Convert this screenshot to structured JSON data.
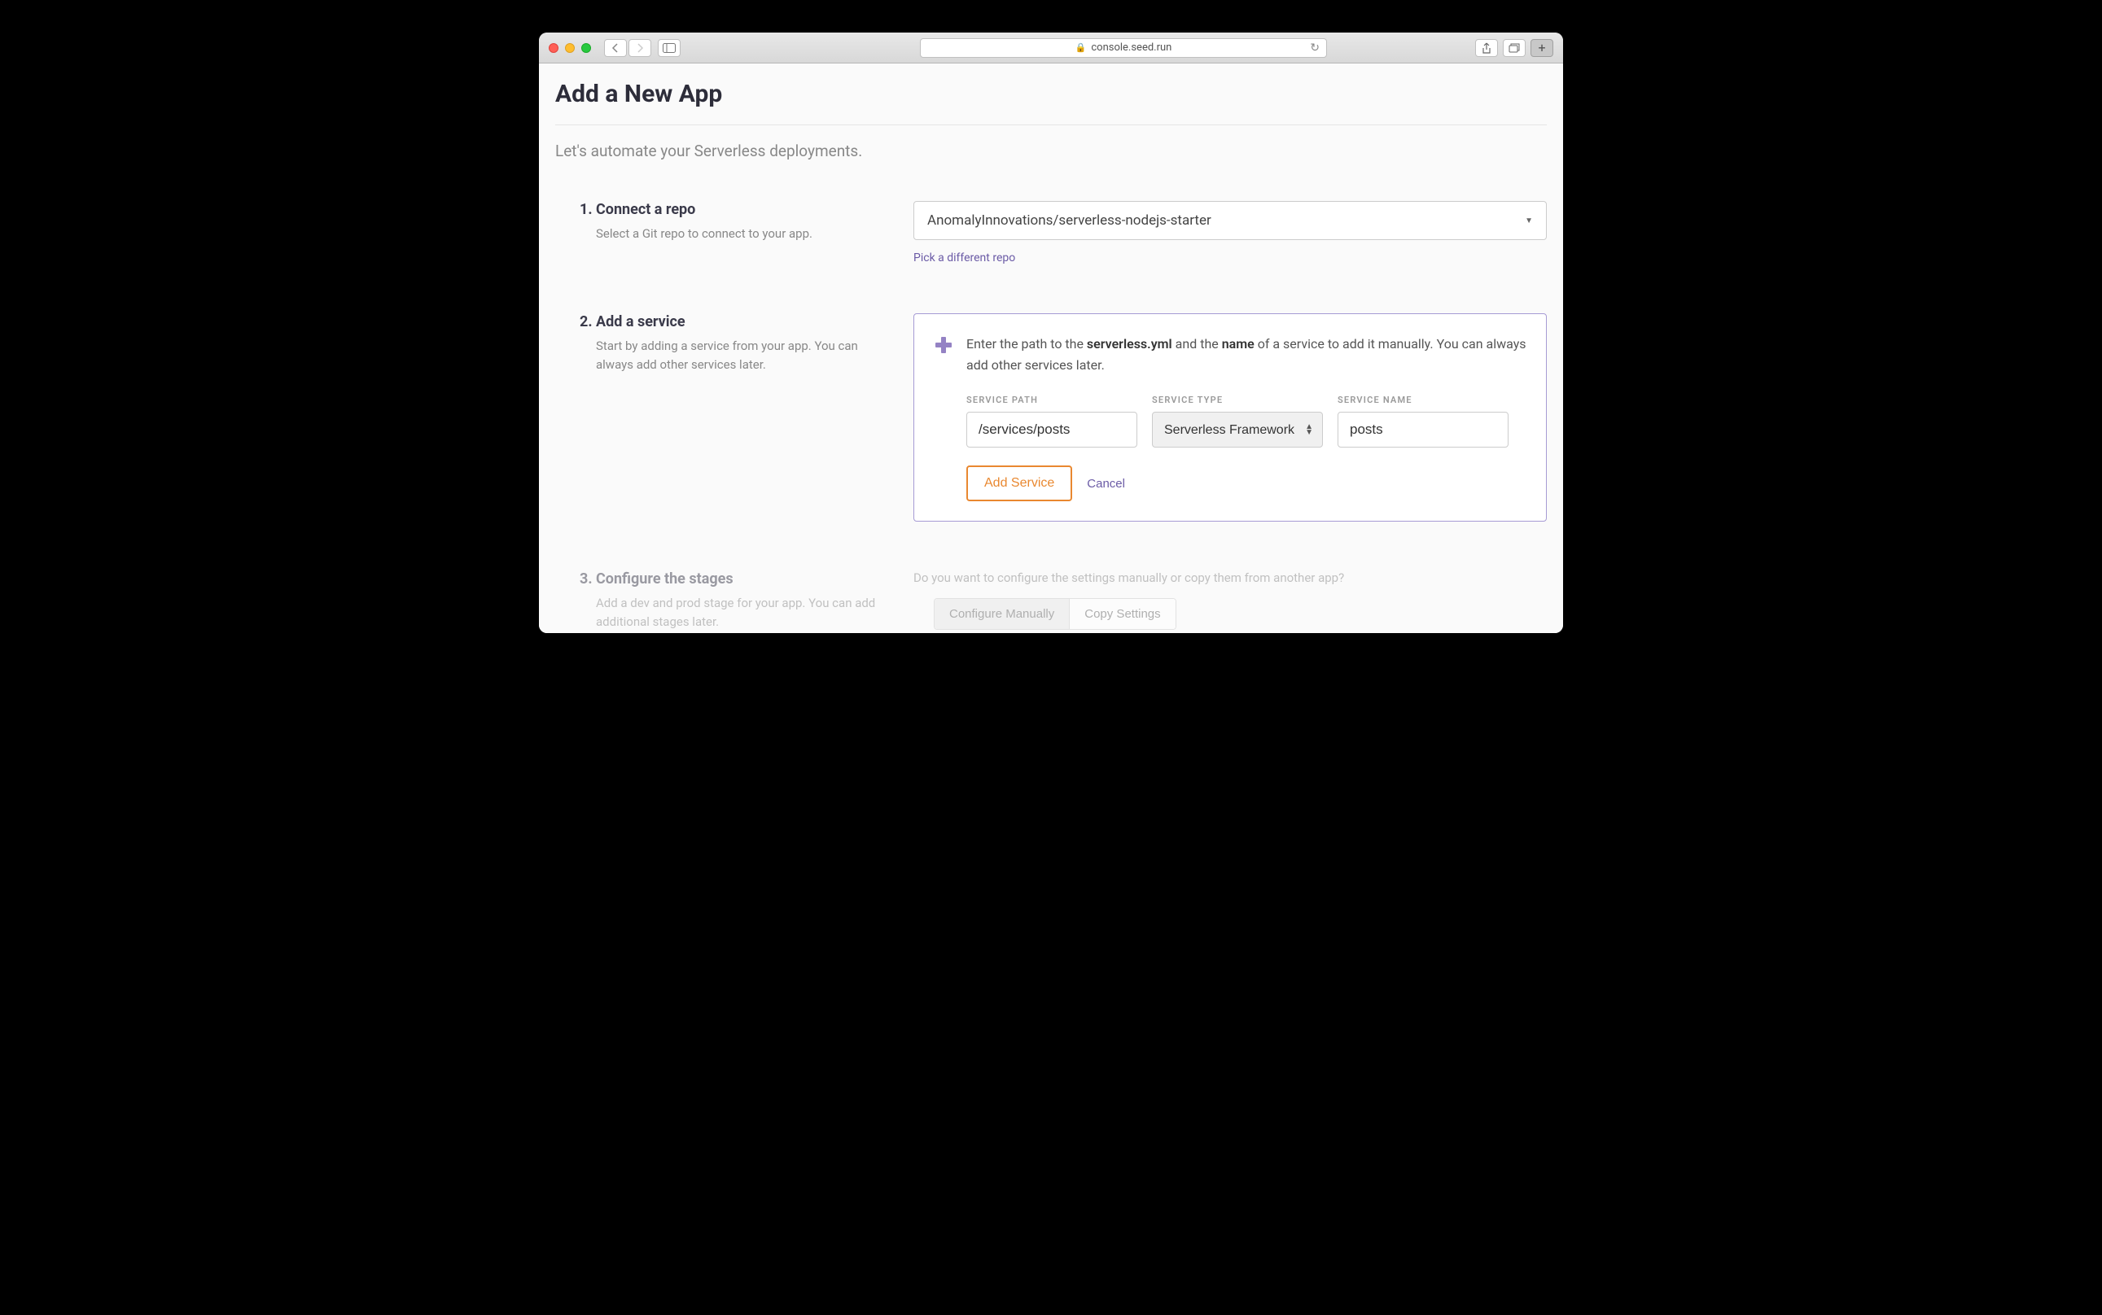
{
  "browser": {
    "url": "console.seed.run"
  },
  "page": {
    "title": "Add a New App",
    "subtitle": "Let's automate your Serverless deployments."
  },
  "step1": {
    "heading": "1. Connect a repo",
    "description": "Select a Git repo to connect to your app.",
    "selected_repo": "AnomalyInnovations/serverless-nodejs-starter",
    "pick_different_link": "Pick a different repo"
  },
  "step2": {
    "heading": "2. Add a service",
    "description": "Start by adding a service from your app. You can always add other services later.",
    "instruction_part1": "Enter the path to the ",
    "instruction_bold1": "serverless.yml",
    "instruction_part2": " and the ",
    "instruction_bold2": "name",
    "instruction_part3": " of a service to add it manually. You can always add other services later.",
    "labels": {
      "path": "SERVICE PATH",
      "type": "SERVICE TYPE",
      "name": "SERVICE NAME"
    },
    "values": {
      "path": "/services/posts",
      "type": "Serverless Framework",
      "name": "posts"
    },
    "add_button": "Add Service",
    "cancel_button": "Cancel"
  },
  "step3": {
    "heading": "3. Configure the stages",
    "description": "Add a dev and prod stage for your app. You can add additional stages later.",
    "prompt": "Do you want to configure the settings manually or copy them from another app?",
    "toggle_manual": "Configure Manually",
    "toggle_copy": "Copy Settings"
  }
}
